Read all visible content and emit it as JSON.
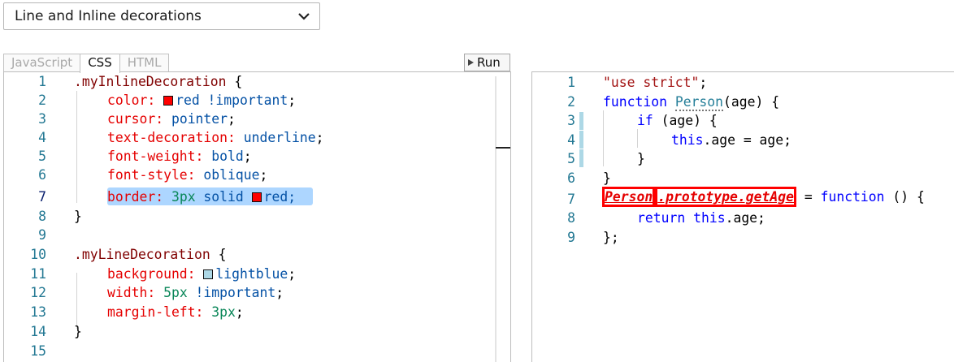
{
  "selector": {
    "value": "Line and Inline decorations"
  },
  "tabs": [
    {
      "label": "JavaScript",
      "active": false
    },
    {
      "label": "CSS",
      "active": true
    },
    {
      "label": "HTML",
      "active": false
    }
  ],
  "run_button": {
    "label": "Run"
  },
  "css_editor": {
    "current_line": 7,
    "lines": [
      {
        "n": "1",
        "t1": ".myInlineDecoration",
        "t2": " {"
      },
      {
        "n": "2",
        "t1": "color: ",
        "t2": "red !important",
        "t3": ";"
      },
      {
        "n": "3",
        "t1": "cursor: ",
        "t2": "pointer",
        "t3": ";"
      },
      {
        "n": "4",
        "t1": "text-decoration: ",
        "t2": "underline",
        "t3": ";"
      },
      {
        "n": "5",
        "t1": "font-weight: ",
        "t2": "bold",
        "t3": ";"
      },
      {
        "n": "6",
        "t1": "font-style: ",
        "t2": "oblique",
        "t3": ";"
      },
      {
        "n": "7",
        "t1": "border: ",
        "t2": "3px",
        "t3": " solid ",
        "t4": "red;"
      },
      {
        "n": "8",
        "t1": "}"
      },
      {
        "n": "9"
      },
      {
        "n": "10",
        "t1": ".myLineDecoration",
        "t2": " {"
      },
      {
        "n": "11",
        "t1": "background: ",
        "t2": "lightblue",
        "t3": ";"
      },
      {
        "n": "12",
        "t1": "width: ",
        "t2": "5px",
        "t3": " !important",
        "t4": ";"
      },
      {
        "n": "13",
        "t1": "margin-left: ",
        "t2": "3px",
        "t3": ";"
      },
      {
        "n": "14",
        "t1": "}"
      },
      {
        "n": "15"
      }
    ]
  },
  "js_editor": {
    "lines": [
      {
        "n": "1",
        "t1": "\"use strict\"",
        "t2": ";"
      },
      {
        "n": "2",
        "t1": "function",
        "t2": " ",
        "t3": "Person",
        "t4": "(age) {"
      },
      {
        "n": "3",
        "t1": "if",
        "t2": " (age) {"
      },
      {
        "n": "4",
        "t1": "this",
        "t2": ".age = age;"
      },
      {
        "n": "5",
        "t1": "}"
      },
      {
        "n": "6",
        "t1": "}"
      },
      {
        "n": "7",
        "t1": "Person",
        "t2": ".prototype.getAge",
        "t3": " = ",
        "t4": "function",
        "t5": " () {"
      },
      {
        "n": "8",
        "t1": "return",
        "t2": " ",
        "t3": "this",
        "t4": ".age;"
      },
      {
        "n": "9",
        "t1": "};"
      }
    ]
  },
  "colors": {
    "red_swatch": "#ff0000",
    "lightblue_swatch": "#add8e6"
  }
}
